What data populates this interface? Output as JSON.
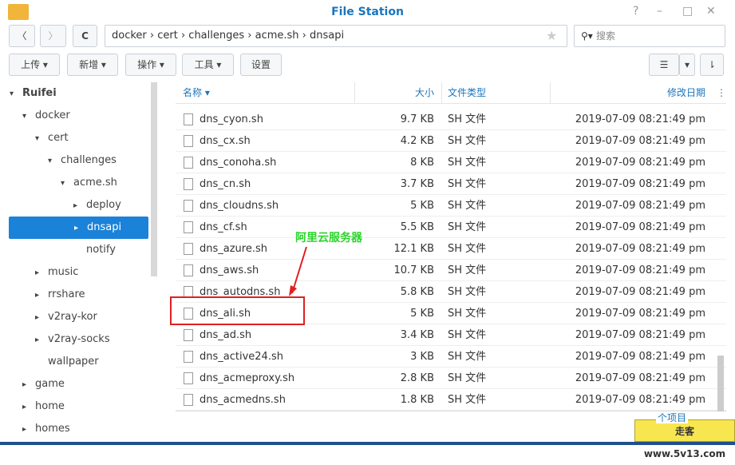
{
  "window": {
    "title": "File Station",
    "help": "?",
    "minimize": "–",
    "maximize": "□",
    "close": "✕"
  },
  "nav": {
    "back": "〈",
    "forward": "〉",
    "refresh": "C",
    "breadcrumb": [
      "docker",
      "cert",
      "challenges",
      "acme.sh",
      "dnsapi"
    ],
    "star": "★",
    "search_placeholder": "搜索"
  },
  "toolbar": {
    "upload": "上传 ▾",
    "create": "新增 ▾",
    "action": "操作 ▾",
    "tools": "工具 ▾",
    "settings": "设置",
    "view": "☰",
    "view_dd": "▾",
    "sort": "⇂"
  },
  "tree": [
    {
      "label": "Ruifei",
      "indent": 0,
      "arrow": "▾",
      "bold": true
    },
    {
      "label": "docker",
      "indent": 1,
      "arrow": "▾"
    },
    {
      "label": "cert",
      "indent": 2,
      "arrow": "▾"
    },
    {
      "label": "challenges",
      "indent": 3,
      "arrow": "▾"
    },
    {
      "label": "acme.sh",
      "indent": 4,
      "arrow": "▾"
    },
    {
      "label": "deploy",
      "indent": 5,
      "arrow": "▸"
    },
    {
      "label": "dnsapi",
      "indent": 5,
      "arrow": "▸",
      "selected": true
    },
    {
      "label": "notify",
      "indent": 5,
      "arrow": ""
    },
    {
      "label": "music",
      "indent": 2,
      "arrow": "▸"
    },
    {
      "label": "rrshare",
      "indent": 2,
      "arrow": "▸"
    },
    {
      "label": "v2ray-kor",
      "indent": 2,
      "arrow": "▸"
    },
    {
      "label": "v2ray-socks",
      "indent": 2,
      "arrow": "▸"
    },
    {
      "label": "wallpaper",
      "indent": 2,
      "arrow": ""
    },
    {
      "label": "game",
      "indent": 1,
      "arrow": "▸"
    },
    {
      "label": "home",
      "indent": 1,
      "arrow": "▸"
    },
    {
      "label": "homes",
      "indent": 1,
      "arrow": "▸"
    }
  ],
  "columns": {
    "name": "名称 ▾",
    "size": "大小",
    "type": "文件类型",
    "modified": "修改日期",
    "more": "⋮"
  },
  "files": [
    {
      "name": "dns_cyon.sh",
      "size": "9.7 KB",
      "type": "SH 文件",
      "modified": "2019-07-09 08:21:49 pm"
    },
    {
      "name": "dns_cx.sh",
      "size": "4.2 KB",
      "type": "SH 文件",
      "modified": "2019-07-09 08:21:49 pm"
    },
    {
      "name": "dns_conoha.sh",
      "size": "8 KB",
      "type": "SH 文件",
      "modified": "2019-07-09 08:21:49 pm"
    },
    {
      "name": "dns_cn.sh",
      "size": "3.7 KB",
      "type": "SH 文件",
      "modified": "2019-07-09 08:21:49 pm"
    },
    {
      "name": "dns_cloudns.sh",
      "size": "5 KB",
      "type": "SH 文件",
      "modified": "2019-07-09 08:21:49 pm"
    },
    {
      "name": "dns_cf.sh",
      "size": "5.5 KB",
      "type": "SH 文件",
      "modified": "2019-07-09 08:21:49 pm"
    },
    {
      "name": "dns_azure.sh",
      "size": "12.1 KB",
      "type": "SH 文件",
      "modified": "2019-07-09 08:21:49 pm"
    },
    {
      "name": "dns_aws.sh",
      "size": "10.7 KB",
      "type": "SH 文件",
      "modified": "2019-07-09 08:21:49 pm"
    },
    {
      "name": "dns_autodns.sh",
      "size": "5.8 KB",
      "type": "SH 文件",
      "modified": "2019-07-09 08:21:49 pm"
    },
    {
      "name": "dns_ali.sh",
      "size": "5 KB",
      "type": "SH 文件",
      "modified": "2019-07-09 08:21:49 pm"
    },
    {
      "name": "dns_ad.sh",
      "size": "3.4 KB",
      "type": "SH 文件",
      "modified": "2019-07-09 08:21:49 pm"
    },
    {
      "name": "dns_active24.sh",
      "size": "3 KB",
      "type": "SH 文件",
      "modified": "2019-07-09 08:21:49 pm"
    },
    {
      "name": "dns_acmeproxy.sh",
      "size": "2.8 KB",
      "type": "SH 文件",
      "modified": "2019-07-09 08:21:49 pm"
    },
    {
      "name": "dns_acmedns.sh",
      "size": "1.8 KB",
      "type": "SH 文件",
      "modified": "2019-07-09 08:21:49 pm"
    }
  ],
  "footer": {
    "count": "个项目"
  },
  "annotation": {
    "text": "阿里云服务器",
    "color": "#2bd52b",
    "box_color": "#e02020"
  },
  "watermark": "走客 www.5v13.com"
}
